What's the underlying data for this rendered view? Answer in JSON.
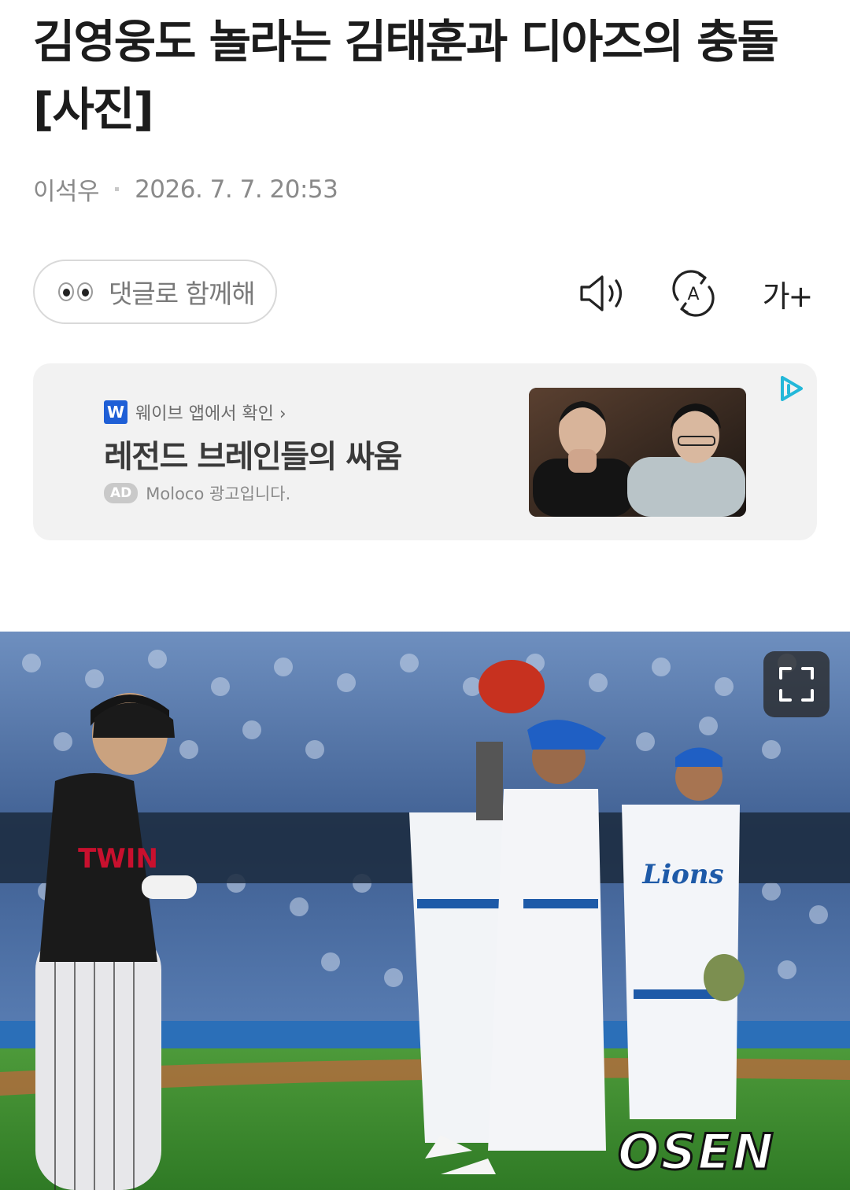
{
  "article": {
    "headline": "김영웅도 놀라는 김태훈과 디아즈의 충돌 [사진]",
    "author": "이석우",
    "datetime": "2026. 7. 7. 20:53"
  },
  "actions": {
    "comment_label": "댓글로 함께해",
    "listen_icon": "speaker-icon",
    "translate_icon": "translate-icon",
    "text_size_label": "가+"
  },
  "ad": {
    "source": "웨이브 앱에서 확인 ›",
    "source_logo": "W",
    "title": "레전드 브레인들의 싸움",
    "badge": "AD",
    "disclosure": "Moloco 광고입니다.",
    "accent_color": "#1f5fd6"
  },
  "photo": {
    "watermark": "OSEN"
  }
}
